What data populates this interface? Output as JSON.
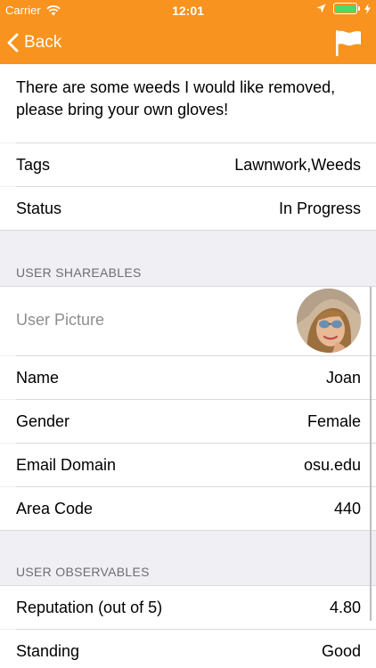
{
  "status_bar": {
    "carrier": "Carrier",
    "time": "12:01"
  },
  "nav": {
    "back_label": "Back"
  },
  "task": {
    "description": "There are some weeds I would like removed, please bring your own gloves!"
  },
  "details": [
    {
      "label": "Tags",
      "value": "Lawnwork,Weeds"
    },
    {
      "label": "Status",
      "value": "In Progress"
    }
  ],
  "user_shareables": {
    "header": "USER SHAREABLES",
    "picture_label": "User Picture",
    "rows": [
      {
        "label": "Name",
        "value": "Joan"
      },
      {
        "label": "Gender",
        "value": "Female"
      },
      {
        "label": "Email Domain",
        "value": "osu.edu"
      },
      {
        "label": "Area Code",
        "value": "440"
      }
    ]
  },
  "user_observables": {
    "header": "USER OBSERVABLES",
    "rows": [
      {
        "label": "Reputation (out of 5)",
        "value": "4.80"
      },
      {
        "label": "Standing",
        "value": "Good"
      }
    ]
  },
  "colors": {
    "accent": "#f7931e",
    "background": "#efeff4",
    "battery": "#4cd964"
  }
}
